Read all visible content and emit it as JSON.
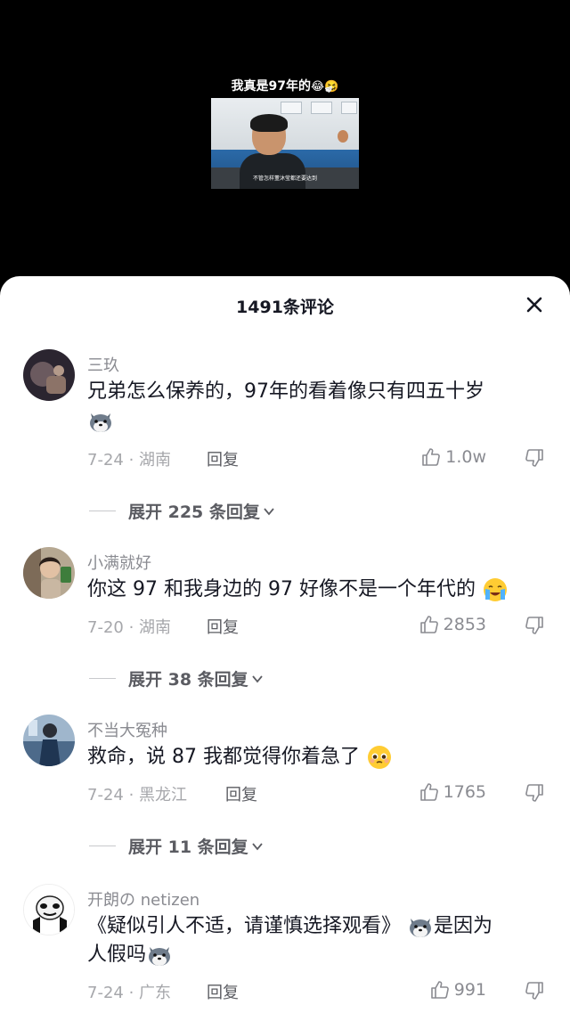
{
  "video": {
    "caption": "我真是97年的",
    "caption_emojis": "😂🤧",
    "subtitle": "不管怎样董沐莹都还要达到"
  },
  "sheet": {
    "title": "1491条评论"
  },
  "comments": [
    {
      "username": "三玖",
      "text": "兄弟怎么保养的，97年的看着像只有四五十岁",
      "date_location": "7-24 · 湖南",
      "reply_label": "回复",
      "likes": "1.0w",
      "expand_label": "展开 225 条回复",
      "trailing_emoji": "husky-emoji-icon"
    },
    {
      "username": "小满就好",
      "text": "你这 97 和我身边的 97 好像不是一个年代的",
      "date_location": "7-20 · 湖南",
      "reply_label": "回复",
      "likes": "2853",
      "expand_label": "展开 38 条回复",
      "trailing_emoji": "crying-emoji-icon"
    },
    {
      "username": "不当大冤种",
      "text": "救命，说 87 我都觉得你着急了",
      "date_location": "7-24 · 黑龙江",
      "reply_label": "回复",
      "likes": "1765",
      "expand_label": "展开 11 条回复",
      "trailing_emoji": "pleading-emoji-icon"
    },
    {
      "username": "开朗の netizen",
      "text_part1": "《疑似引人不适，请谨慎选择观看》",
      "text_part2": "是因为",
      "text_part3": "人假吗",
      "date_location": "7-24 · 广东",
      "reply_label": "回复",
      "likes": "991"
    }
  ],
  "colors": {
    "text_primary": "#161823",
    "text_secondary": "#8a8b91",
    "meta": "#a6a7ab"
  }
}
